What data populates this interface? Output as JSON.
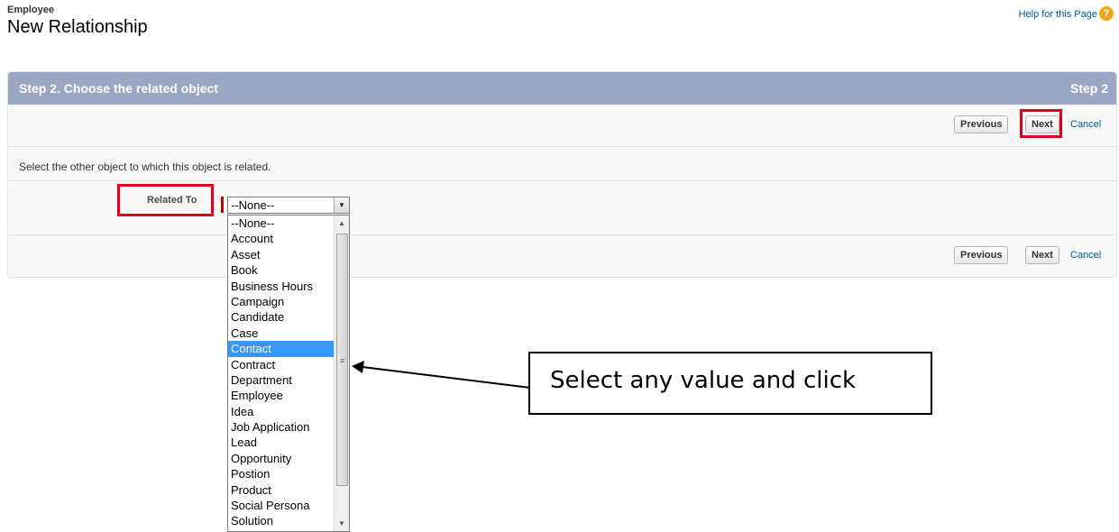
{
  "header": {
    "breadcrumb": "Employee",
    "title": "New Relationship",
    "help_link": "Help for this Page",
    "help_icon": "help-icon"
  },
  "panel": {
    "step_title": "Step 2. Choose the related object",
    "step_label": "Step 2",
    "previous_label": "Previous",
    "next_label": "Next",
    "cancel_label": "Cancel",
    "instruction": "Select the other object to which this object is related."
  },
  "field": {
    "label": "Related To",
    "selected_value": "--None--"
  },
  "dropdown": {
    "options": [
      "--None--",
      "Account",
      "Asset",
      "Book",
      "Business Hours",
      "Campaign",
      "Candidate",
      "Case",
      "Contact",
      "Contract",
      "Department",
      "Employee",
      "Idea",
      "Job Application",
      "Lead",
      "Opportunity",
      "Postion",
      "Product",
      "Social Persona",
      "Solution"
    ],
    "highlighted": "Contact"
  },
  "annotation": {
    "callout_text": "Select any value and click",
    "highlight_color": "#e0001b"
  },
  "colors": {
    "header_bar": "#9aa6c3",
    "link": "#015ba7",
    "selected_option": "#3399ff"
  }
}
